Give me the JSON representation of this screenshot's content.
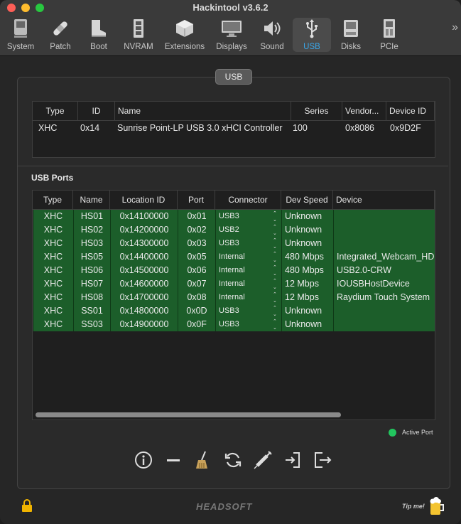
{
  "window": {
    "title": "Hackintool v3.6.2"
  },
  "toolbar": {
    "items": [
      {
        "label": "System",
        "icon": "computer-icon"
      },
      {
        "label": "Patch",
        "icon": "bandage-icon"
      },
      {
        "label": "Boot",
        "icon": "boot-icon"
      },
      {
        "label": "NVRAM",
        "icon": "memory-chip-icon"
      },
      {
        "label": "Extensions",
        "icon": "kext-box-icon"
      },
      {
        "label": "Displays",
        "icon": "display-icon"
      },
      {
        "label": "Sound",
        "icon": "speaker-icon"
      },
      {
        "label": "USB",
        "icon": "usb-icon"
      },
      {
        "label": "Disks",
        "icon": "disk-icon"
      },
      {
        "label": "PCIe",
        "icon": "pcie-card-icon"
      }
    ],
    "overflow": "»",
    "active": "USB"
  },
  "panel": {
    "tab_label": "USB"
  },
  "controllers": {
    "headers": [
      "Type",
      "ID",
      "Name",
      "Series",
      "Vendor...",
      "Device ID"
    ],
    "rows": [
      {
        "type": "XHC",
        "id": "0x14",
        "name": "Sunrise Point-LP USB 3.0 xHCI Controller",
        "series": "100",
        "vendor": "0x8086",
        "device": "0x9D2F"
      }
    ]
  },
  "usb_ports": {
    "section_label": "USB Ports",
    "headers": [
      "Type",
      "Name",
      "Location ID",
      "Port",
      "Connector",
      "Dev Speed",
      "Device"
    ],
    "rows": [
      {
        "type": "XHC",
        "name": "HS01",
        "location": "0x14100000",
        "port": "0x01",
        "connector": "USB3",
        "speed": "Unknown",
        "device": ""
      },
      {
        "type": "XHC",
        "name": "HS02",
        "location": "0x14200000",
        "port": "0x02",
        "connector": "USB2",
        "speed": "Unknown",
        "device": ""
      },
      {
        "type": "XHC",
        "name": "HS03",
        "location": "0x14300000",
        "port": "0x03",
        "connector": "USB3",
        "speed": "Unknown",
        "device": ""
      },
      {
        "type": "XHC",
        "name": "HS05",
        "location": "0x14400000",
        "port": "0x05",
        "connector": "Internal",
        "speed": "480 Mbps",
        "device": "Integrated_Webcam_HD"
      },
      {
        "type": "XHC",
        "name": "HS06",
        "location": "0x14500000",
        "port": "0x06",
        "connector": "Internal",
        "speed": "480 Mbps",
        "device": "USB2.0-CRW"
      },
      {
        "type": "XHC",
        "name": "HS07",
        "location": "0x14600000",
        "port": "0x07",
        "connector": "Internal",
        "speed": "12 Mbps",
        "device": "IOUSBHostDevice"
      },
      {
        "type": "XHC",
        "name": "HS08",
        "location": "0x14700000",
        "port": "0x08",
        "connector": "Internal",
        "speed": "12 Mbps",
        "device": "Raydium Touch System"
      },
      {
        "type": "XHC",
        "name": "SS01",
        "location": "0x14800000",
        "port": "0x0D",
        "connector": "USB3",
        "speed": "Unknown",
        "device": ""
      },
      {
        "type": "XHC",
        "name": "SS03",
        "location": "0x14900000",
        "port": "0x0F",
        "connector": "USB3",
        "speed": "Unknown",
        "device": ""
      }
    ],
    "row_color": "#1c5e2a"
  },
  "legend": {
    "label": "Active Port",
    "color": "#22c55e"
  },
  "actions": [
    {
      "name": "info-icon"
    },
    {
      "name": "minus-icon"
    },
    {
      "name": "broom-icon"
    },
    {
      "name": "refresh-icon"
    },
    {
      "name": "syringe-icon"
    },
    {
      "name": "import-icon"
    },
    {
      "name": "export-icon"
    }
  ],
  "footer": {
    "brand": "HEADSOFT",
    "tip": "Tip me!",
    "lock_icon": "lock-icon",
    "beer_icon": "beer-icon"
  }
}
